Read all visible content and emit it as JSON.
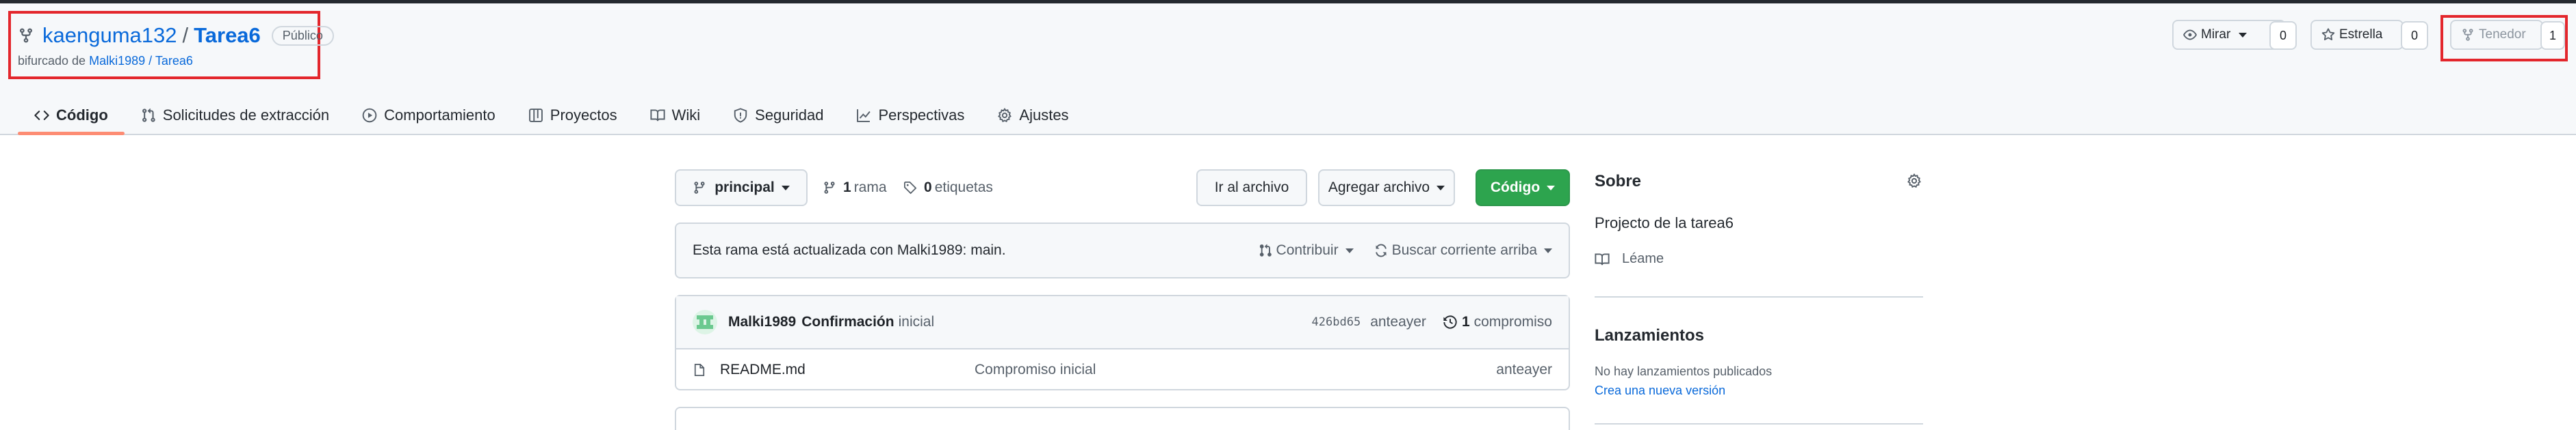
{
  "colors": {
    "accent": "#0969da",
    "primary_button": "#2da44e",
    "highlight_box": "#e3262c",
    "tab_underline": "#fd8c73"
  },
  "repo": {
    "owner": "kaenguma132",
    "separator": "/",
    "name": "Tarea6",
    "visibility": "Público",
    "forked_prefix": "bifurcado de",
    "forked_from": "Malki1989 / Tarea6"
  },
  "actions": {
    "watch": {
      "label": "Mirar",
      "count": "0",
      "icon": "eye-icon"
    },
    "star": {
      "label": "Estrella",
      "count": "0",
      "icon": "star-icon"
    },
    "fork": {
      "label": "Tenedor",
      "count": "1",
      "icon": "fork-icon"
    }
  },
  "tabs": [
    {
      "label": "Código",
      "icon": "code-icon",
      "active": true
    },
    {
      "label": "Solicitudes de extracción",
      "icon": "pull-request-icon"
    },
    {
      "label": "Comportamiento",
      "icon": "play-icon"
    },
    {
      "label": "Proyectos",
      "icon": "table-icon"
    },
    {
      "label": "Wiki",
      "icon": "book-icon"
    },
    {
      "label": "Seguridad",
      "icon": "shield-icon"
    },
    {
      "label": "Perspectivas",
      "icon": "graph-icon"
    },
    {
      "label": "Ajustes",
      "icon": "gear-icon"
    }
  ],
  "toolbar": {
    "branch": "principal",
    "branches_count": "1",
    "branches_label": "rama",
    "tags_count": "0",
    "tags_label": "etiquetas",
    "goto_file": "Ir al archivo",
    "add_file": "Agregar archivo",
    "code": "Código"
  },
  "banner": {
    "text": "Esta rama está actualizada con Malki1989: main.",
    "contribute": "Contribuir",
    "fetch_upstream": "Buscar corriente arriba"
  },
  "commit": {
    "author": "Malki1989",
    "message_bold": "Confirmación",
    "message_rest": "inicial",
    "hash": "426bd65",
    "time": "anteayer",
    "count": "1",
    "count_label": "compromiso"
  },
  "files": [
    {
      "name": "README.md",
      "message": "Compromiso inicial",
      "time": "anteayer"
    }
  ],
  "about": {
    "title": "Sobre",
    "description": "Projecto de la tarea6",
    "readme": "Léame"
  },
  "releases": {
    "title": "Lanzamientos",
    "none": "No hay lanzamientos publicados",
    "create": "Crea una nueva versión"
  }
}
